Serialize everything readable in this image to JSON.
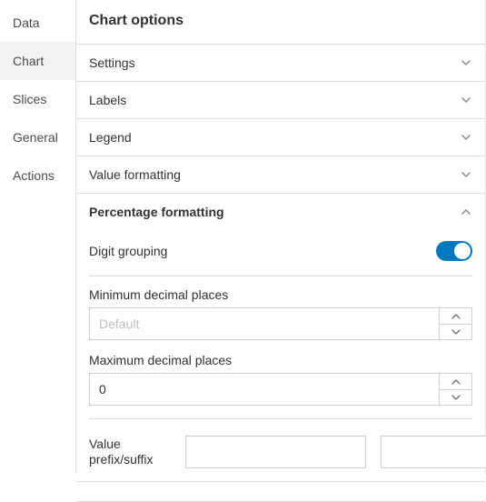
{
  "sidebar": {
    "items": [
      {
        "label": "Data",
        "selected": false
      },
      {
        "label": "Chart",
        "selected": true
      },
      {
        "label": "Slices",
        "selected": false
      },
      {
        "label": "General",
        "selected": false
      },
      {
        "label": "Actions",
        "selected": false
      }
    ]
  },
  "page": {
    "title": "Chart options"
  },
  "sections": {
    "settings": {
      "label": "Settings",
      "expanded": false
    },
    "labels": {
      "label": "Labels",
      "expanded": false
    },
    "legend": {
      "label": "Legend",
      "expanded": false
    },
    "valueFormatting": {
      "label": "Value formatting",
      "expanded": false
    },
    "percentFormatting": {
      "label": "Percentage formatting",
      "expanded": true
    }
  },
  "percentFormatting": {
    "digitGrouping": {
      "label": "Digit grouping",
      "enabled": true
    },
    "minDecimals": {
      "label": "Minimum decimal places",
      "placeholder": "Default",
      "value": ""
    },
    "maxDecimals": {
      "label": "Maximum decimal places",
      "value": "0"
    },
    "prefixSuffix": {
      "label": "Value prefix/suffix",
      "prefix": "",
      "suffix": ""
    }
  }
}
